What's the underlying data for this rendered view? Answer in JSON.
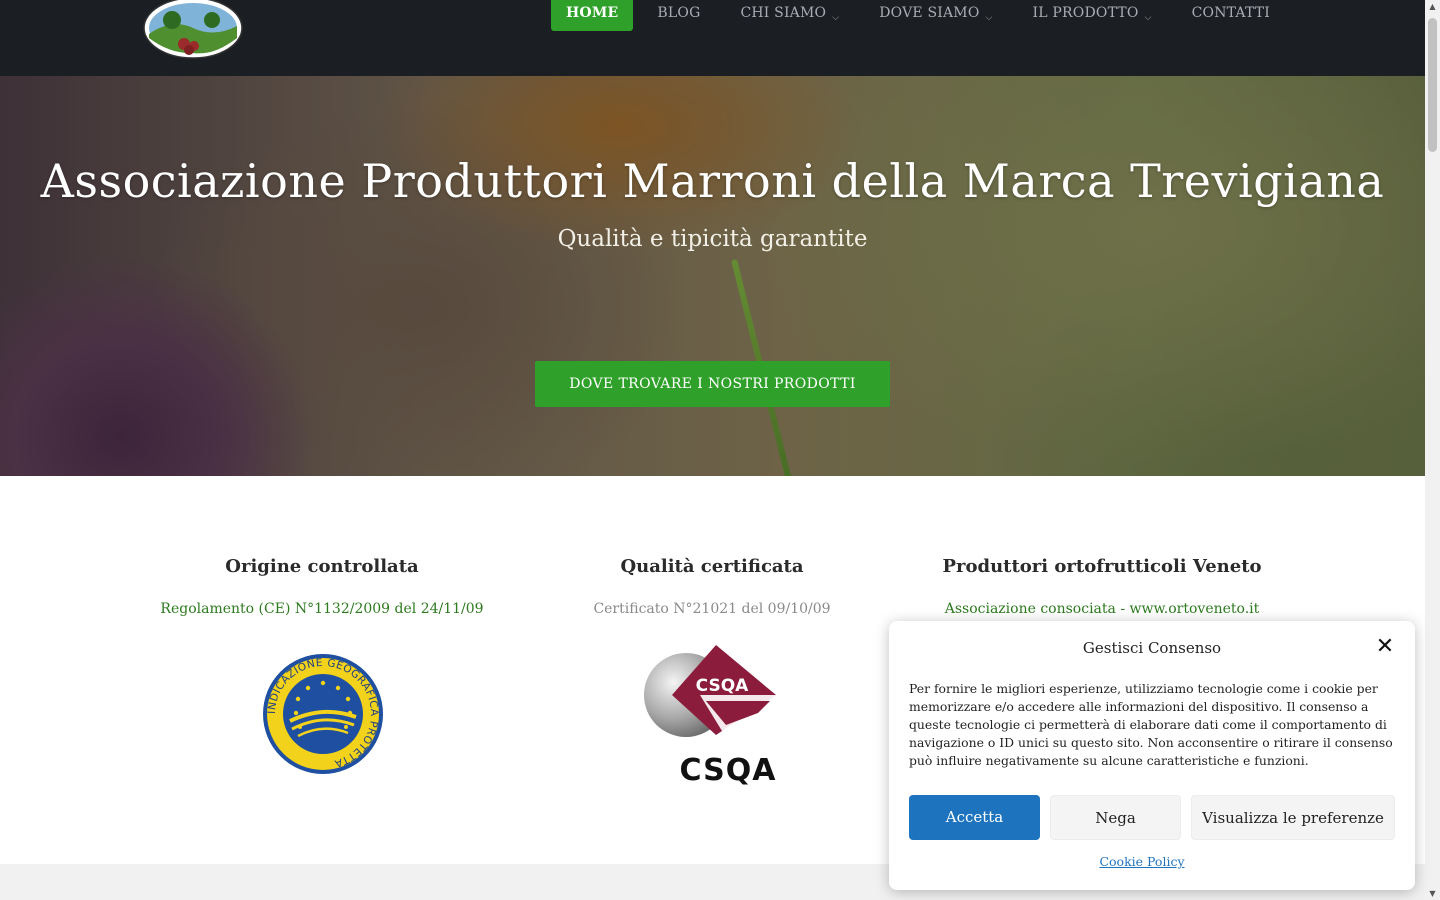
{
  "header": {
    "nav": [
      {
        "label": "HOME",
        "active": true
      },
      {
        "label": "BLOG"
      },
      {
        "label": "CHI SIAMO",
        "dropdown": true
      },
      {
        "label": "DOVE SIAMO",
        "dropdown": true
      },
      {
        "label": "IL PRODOTTO",
        "dropdown": true
      },
      {
        "label": "CONTATTI"
      }
    ]
  },
  "hero": {
    "title": "Associazione Produttori Marroni della Marca Trevigiana",
    "subtitle": "Qualità e tipicità garantite",
    "cta": "DOVE TROVARE I NOSTRI PRODOTTI"
  },
  "features": [
    {
      "title": "Origine controllata",
      "subtitle": "Regolamento (CE) N°1132/2009 del 24/11/09"
    },
    {
      "title": "Qualità certificata",
      "subtitle": "Certificato N°21021 del 09/10/09"
    },
    {
      "title": "Produttori ortofrutticoli Veneto",
      "subtitle": "Associazione consociata - www.ortoveneto.it"
    }
  ],
  "badges": {
    "igp_text": "INDICAZIONE GEOGRAFICA PROTETTA",
    "csqa_text": "CSQA"
  },
  "consent": {
    "title": "Gestisci Consenso",
    "body": "Per fornire le migliori esperienze, utilizziamo tecnologie come i cookie per memorizzare e/o accedere alle informazioni del dispositivo. Il consenso a queste tecnologie ci permetterà di elaborare dati come il comportamento di navigazione o ID unici su questo sito. Non acconsentire o ritirare il consenso può influire negativamente su alcune caratteristiche e funzioni.",
    "accept": "Accetta",
    "deny": "Nega",
    "preferences": "Visualizza le preferenze",
    "policy_link": "Cookie Policy"
  },
  "colors": {
    "nav_bg": "#1b1e22",
    "accent_green": "#2fa12a",
    "link_blue": "#1e73be"
  }
}
